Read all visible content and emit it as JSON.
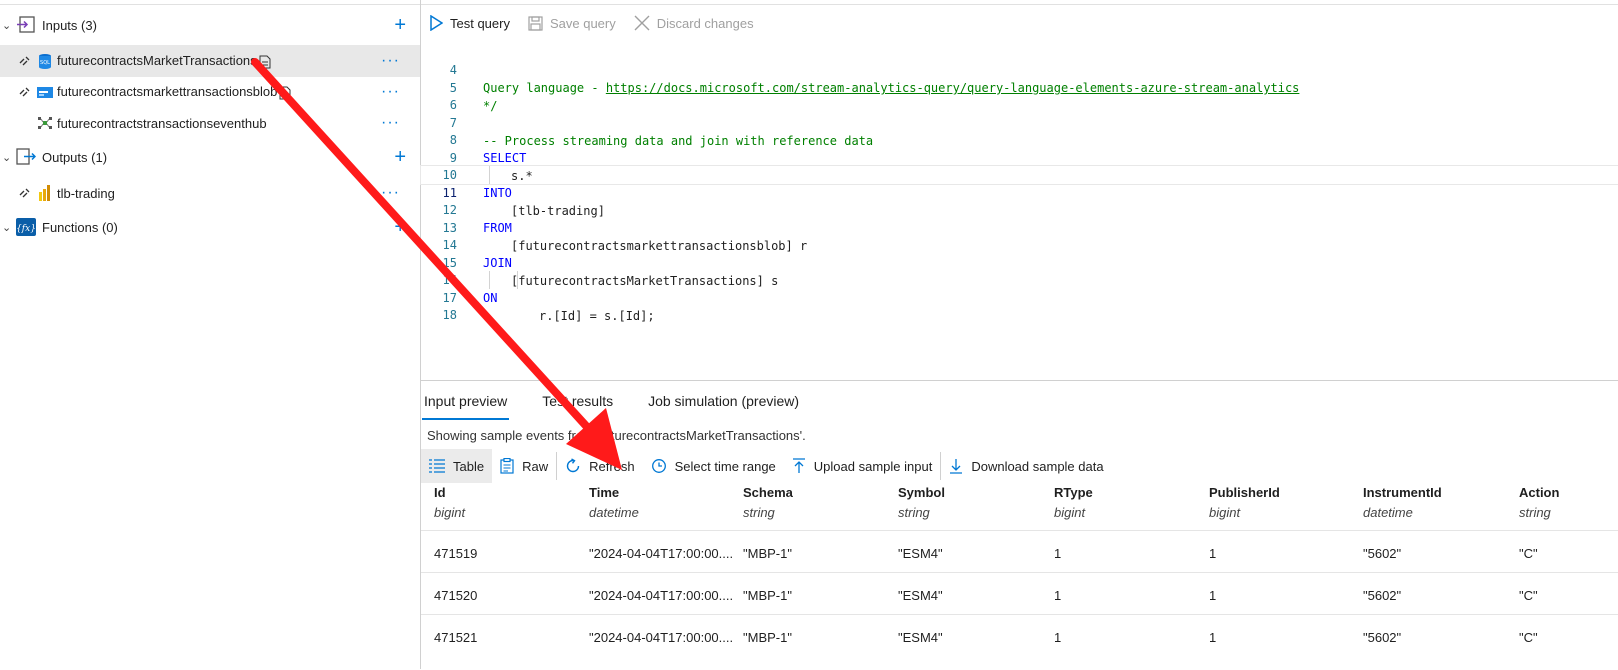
{
  "sidebar": {
    "inputs_label": "Inputs (3)",
    "outputs_label": "Outputs (1)",
    "functions_label": "Functions (0)",
    "add_symbol": "+",
    "more_symbol": "···",
    "inputs": [
      {
        "name": "futurecontractsMarketTransactions"
      },
      {
        "name": "futurecontractsmarkettransactionsblob"
      },
      {
        "name": "futurecontractstransactionseventhub"
      }
    ],
    "outputs": [
      {
        "name": "tlb-trading"
      }
    ]
  },
  "toolbar": {
    "test_query": "Test query",
    "save_query": "Save query",
    "discard_changes": "Discard changes"
  },
  "editor": {
    "lines": [
      {
        "n": "4",
        "text": "Query language - "
      },
      {
        "n": "5",
        "text": "*/"
      },
      {
        "n": "6",
        "text": ""
      },
      {
        "n": "7",
        "text": "-- Process streaming data and join with reference data"
      },
      {
        "n": "8",
        "text": "SELECT"
      },
      {
        "n": "9",
        "text": "s.*"
      },
      {
        "n": "10",
        "text": "INTO"
      },
      {
        "n": "11",
        "text": "[tlb-trading]"
      },
      {
        "n": "12",
        "text": "FROM"
      },
      {
        "n": "13",
        "text": "[futurecontractsmarkettransactionsblob] r"
      },
      {
        "n": "14",
        "text": "JOIN"
      },
      {
        "n": "15",
        "text": "[futurecontractsMarketTransactions] s"
      },
      {
        "n": "16",
        "text": "ON"
      },
      {
        "n": "17",
        "text": "r.[Id] = s.[Id];"
      },
      {
        "n": "18",
        "text": ""
      }
    ],
    "doc_link": "https://docs.microsoft.com/stream-analytics-query/query-language-elements-azure-stream-analytics"
  },
  "results": {
    "tabs": [
      "Input preview",
      "Test results",
      "Job simulation (preview)"
    ],
    "showing_text": "Showing sample events from 'futurecontractsMarketTransactions'.",
    "toolbar": {
      "table": "Table",
      "raw": "Raw",
      "refresh": "Refresh",
      "select_time_range": "Select time range",
      "upload_sample_input": "Upload sample input",
      "download_sample_data": "Download sample data"
    },
    "columns": [
      {
        "name": "Id",
        "type": "bigint"
      },
      {
        "name": "Time",
        "type": "datetime"
      },
      {
        "name": "Schema",
        "type": "string"
      },
      {
        "name": "Symbol",
        "type": "string"
      },
      {
        "name": "RType",
        "type": "bigint"
      },
      {
        "name": "PublisherId",
        "type": "bigint"
      },
      {
        "name": "InstrumentId",
        "type": "datetime"
      },
      {
        "name": "Action",
        "type": "string"
      }
    ],
    "rows": [
      [
        "471519",
        "\"2024-04-04T17:00:00....",
        "\"MBP-1\"",
        "\"ESM4\"",
        "1",
        "1",
        "\"5602\"",
        "\"C\""
      ],
      [
        "471520",
        "\"2024-04-04T17:00:00....",
        "\"MBP-1\"",
        "\"ESM4\"",
        "1",
        "1",
        "\"5602\"",
        "\"C\""
      ],
      [
        "471521",
        "\"2024-04-04T17:00:00....",
        "\"MBP-1\"",
        "\"ESM4\"",
        "1",
        "1",
        "\"5602\"",
        "\"C\""
      ]
    ]
  },
  "colors": {
    "accent": "#0078d4",
    "annotation_arrow": "#ff1a1a",
    "keyword": "#0000ff",
    "comment": "#008000"
  }
}
